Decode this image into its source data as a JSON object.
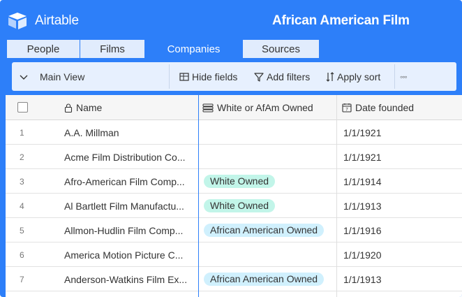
{
  "app": {
    "brand": "Airtable",
    "base_title": "African American Film"
  },
  "tabs": [
    {
      "label": "People",
      "active": false
    },
    {
      "label": "Films",
      "active": false
    },
    {
      "label": "Companies",
      "active": true
    },
    {
      "label": "Sources",
      "active": false
    }
  ],
  "viewbar": {
    "view_name": "Main View",
    "hide_fields": "Hide fields",
    "add_filters": "Add filters",
    "apply_sort": "Apply sort",
    "more": "◦◦◦"
  },
  "columns": {
    "name": "Name",
    "owned": "White or AfAm Owned",
    "founded": "Date founded"
  },
  "colors": {
    "accent": "#2d7ff9",
    "white_owned_pill": "#c2f5e9",
    "afam_owned_pill": "#d0f0fd"
  },
  "rows": [
    {
      "num": "1",
      "name": "A.A. Millman",
      "owned": "",
      "founded": "1/1/1921"
    },
    {
      "num": "2",
      "name": "Acme Film Distribution Co...",
      "owned": "",
      "founded": "1/1/1921"
    },
    {
      "num": "3",
      "name": "Afro-American Film Comp...",
      "owned": "White Owned",
      "founded": "1/1/1914"
    },
    {
      "num": "4",
      "name": "Al Bartlett Film Manufactu...",
      "owned": "White Owned",
      "founded": "1/1/1913"
    },
    {
      "num": "5",
      "name": "Allmon-Hudlin Film Comp...",
      "owned": "African American Owned",
      "founded": "1/1/1916"
    },
    {
      "num": "6",
      "name": "America Motion Picture C...",
      "owned": "",
      "founded": "1/1/1920"
    },
    {
      "num": "7",
      "name": "Anderson-Watkins Film Ex...",
      "owned": "African American Owned",
      "founded": "1/1/1913"
    }
  ]
}
